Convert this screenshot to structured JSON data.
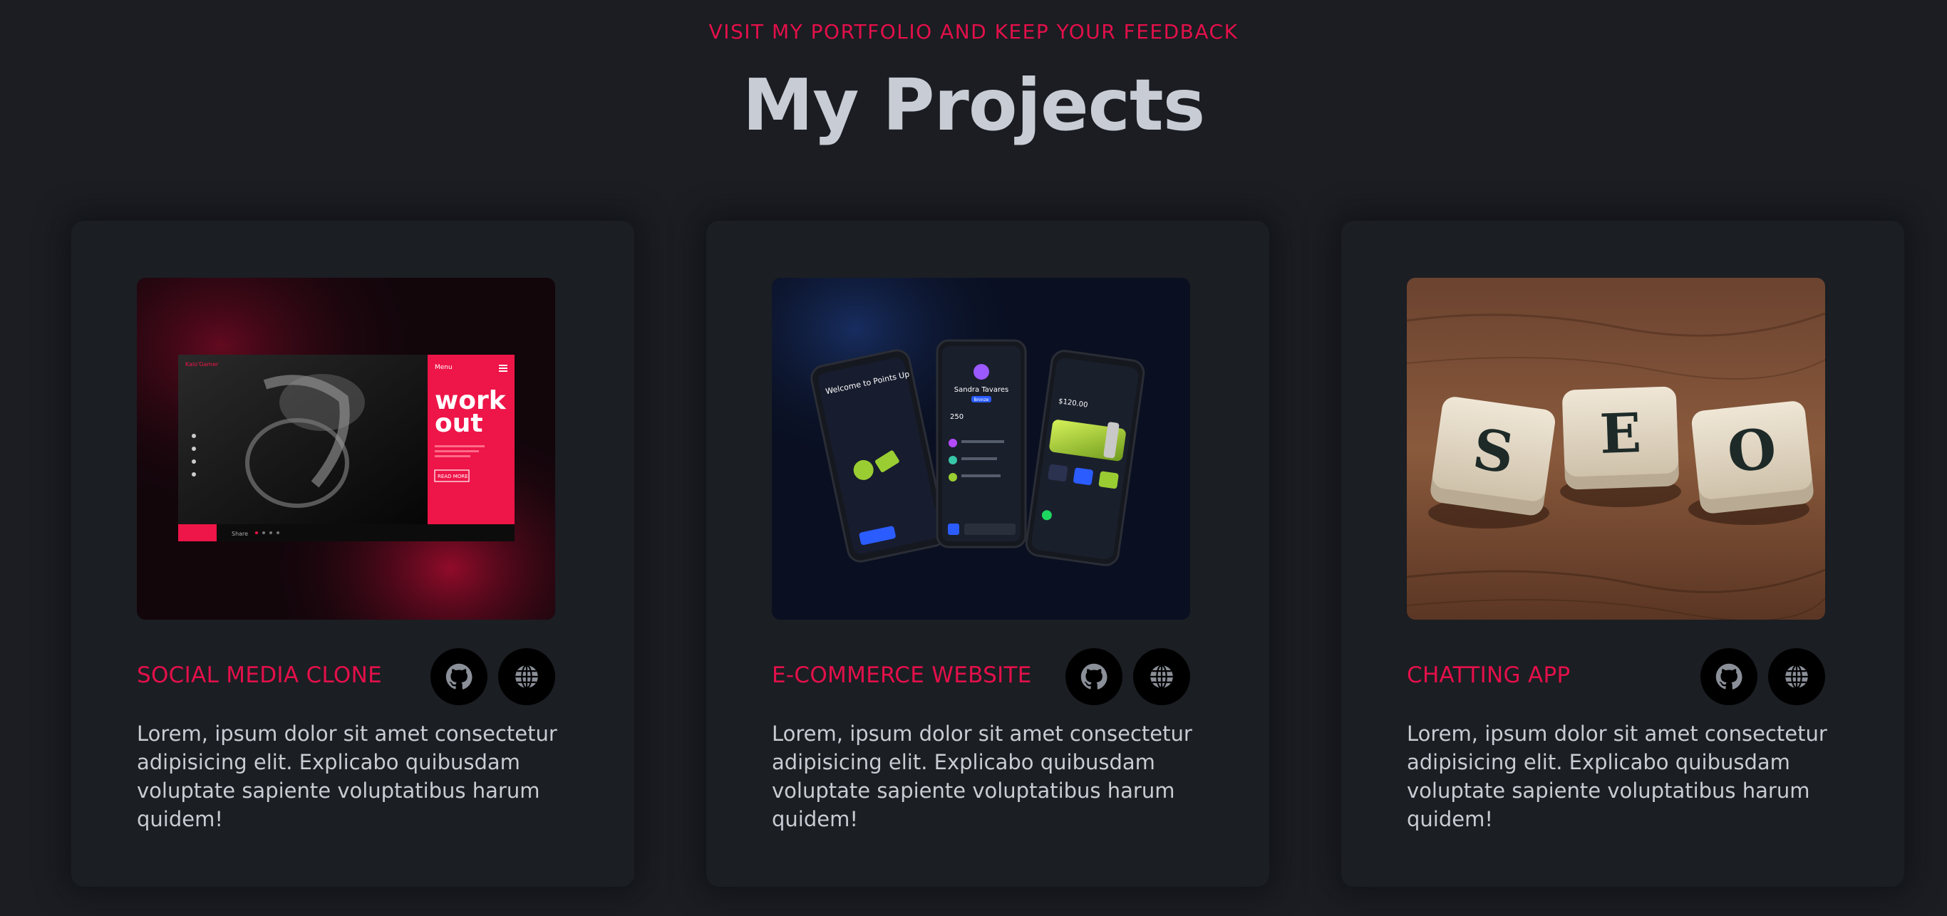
{
  "header": {
    "eyebrow": "VISIT MY PORTFOLIO AND KEEP YOUR FEEDBACK",
    "title": "My Projects"
  },
  "projects": [
    {
      "title": "SOCIAL MEDIA CLONE",
      "description": "Lorem, ipsum dolor sit amet consectetur adipisicing elit. Explicabo quibusdam voluptate sapiente voluptatibus harum quidem!",
      "image_text": {
        "logo": "Kalo'Gamer",
        "menu": "Menu",
        "headline_1": "work",
        "headline_2": "out",
        "body": "Lorem ipsum dolor sit amet consectetur adipiscing",
        "button": "READ MORE",
        "share": "Share"
      },
      "github_icon": "github-icon",
      "web_icon": "globe-icon"
    },
    {
      "title": "E-COMMERCE WEBSITE",
      "description": "Lorem, ipsum dolor sit amet consectetur adipisicing elit. Explicabo quibusdam voluptate sapiente voluptatibus harum quidem!",
      "image_text": {
        "welcome": "Welcome to Points Up",
        "name": "Sandra Tavares",
        "badge": "Bronze",
        "points": "250",
        "balance": "$120.00"
      },
      "github_icon": "github-icon",
      "web_icon": "globe-icon"
    },
    {
      "title": "CHATTING APP",
      "description": "Lorem, ipsum dolor sit amet consectetur adipisicing elit. Explicabo quibusdam voluptate sapiente voluptatibus harum quidem!",
      "image_text": {
        "tile_1": "S",
        "tile_2": "E",
        "tile_3": "O"
      },
      "github_icon": "github-icon",
      "web_icon": "globe-icon"
    }
  ],
  "colors": {
    "background": "#1b1d22",
    "accent": "#e3104a",
    "title": "#c8cdd5",
    "text": "#c8ccd3"
  }
}
